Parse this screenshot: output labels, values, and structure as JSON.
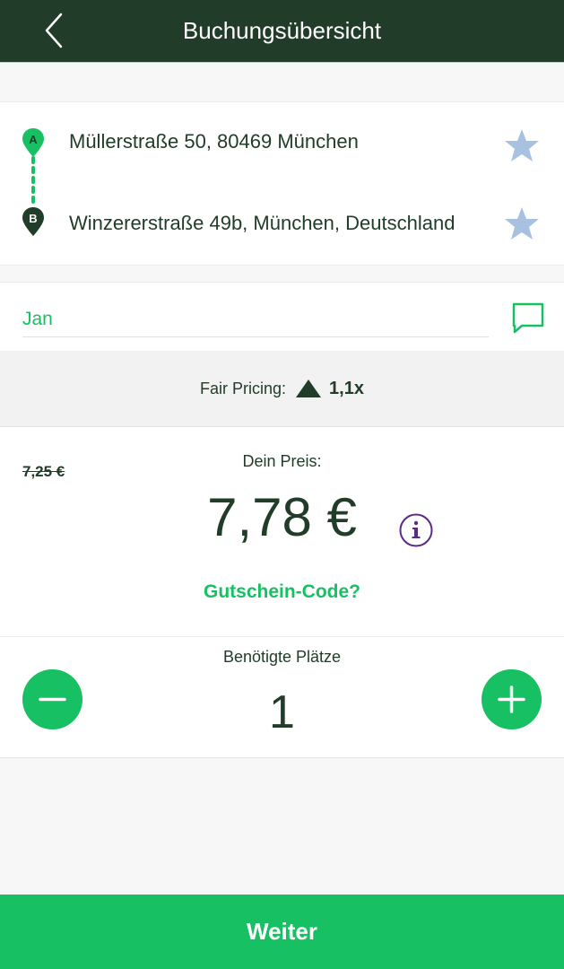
{
  "header": {
    "title": "Buchungsübersicht",
    "back_icon": "chevron-left-icon"
  },
  "route": {
    "from": {
      "marker": "A",
      "address": "Müllerstraße 50, 80469 München"
    },
    "to": {
      "marker": "B",
      "address": "Winzererstraße 49b, München, Deutschland"
    }
  },
  "passenger": {
    "name": "Jan"
  },
  "fair_pricing": {
    "label": "Fair Pricing:",
    "value": "1,1x"
  },
  "price": {
    "old": "7,25 €",
    "label": "Dein Preis:",
    "value": "7,78 €",
    "voucher_link": "Gutschein-Code?"
  },
  "seats": {
    "label": "Benötigte Plätze",
    "value": "1"
  },
  "footer": {
    "button_label": "Weiter"
  },
  "colors": {
    "header_bg": "#213d2a",
    "accent_green": "#17c163",
    "text_dark": "#213d2a",
    "star": "#a9c1e0",
    "info_purple": "#5c2a8a"
  }
}
